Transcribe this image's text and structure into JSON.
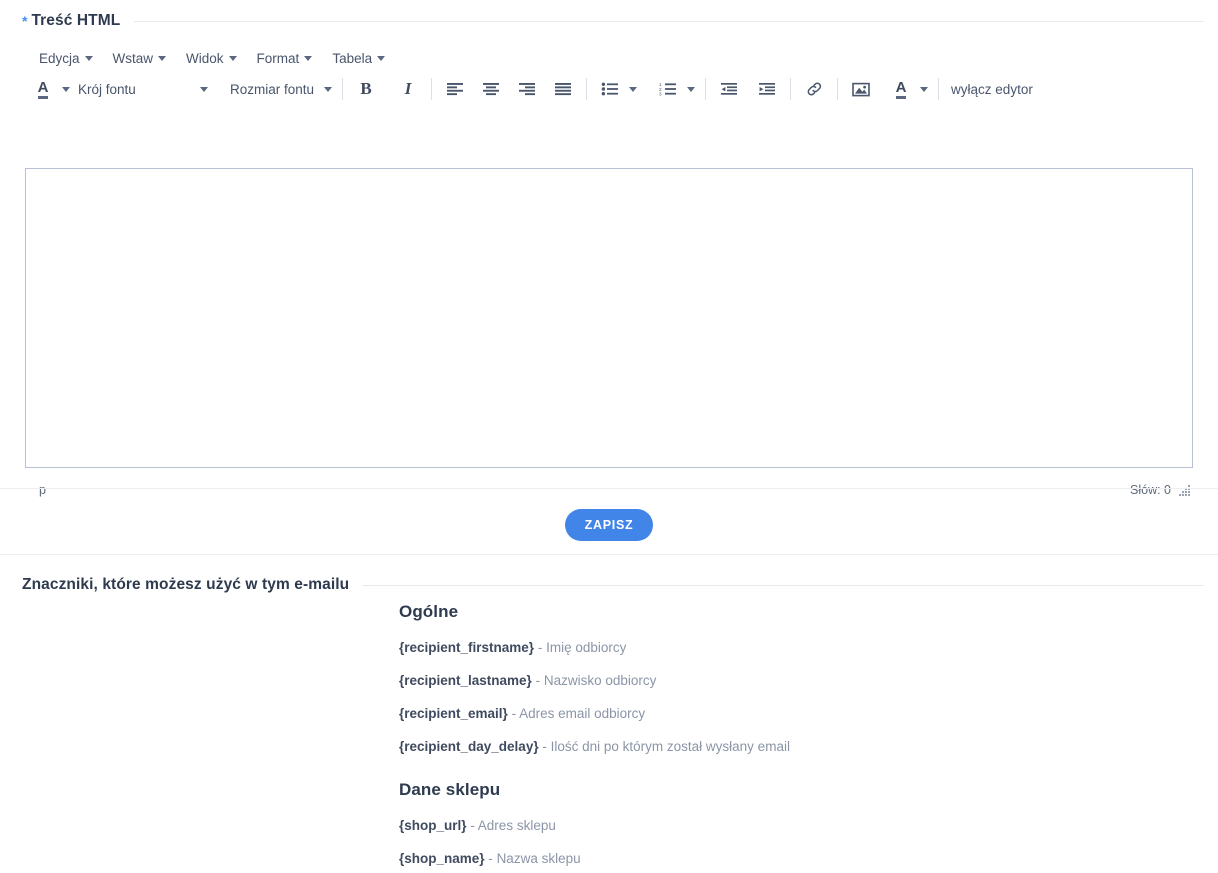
{
  "header": {
    "required_mark": "*",
    "title": "Treść HTML"
  },
  "editor": {
    "menubar": [
      {
        "label": "Edycja",
        "name": "menu-edycja"
      },
      {
        "label": "Wstaw",
        "name": "menu-wstaw"
      },
      {
        "label": "Widok",
        "name": "menu-widok"
      },
      {
        "label": "Format",
        "name": "menu-format"
      },
      {
        "label": "Tabela",
        "name": "menu-tabela"
      }
    ],
    "toolbar": {
      "text_color_icon": "text-color-A-icon",
      "font_family_label": "Krój fontu",
      "font_size_label": "Rozmiar fontu",
      "bold_icon": "bold-icon",
      "italic_icon": "italic-icon",
      "align_left_icon": "align-left-icon",
      "align_center_icon": "align-center-icon",
      "align_right_icon": "align-right-icon",
      "align_justify_icon": "align-justify-icon",
      "bullet_list_icon": "bullet-list-icon",
      "numbered_list_icon": "numbered-list-icon",
      "outdent_icon": "outdent-icon",
      "indent_icon": "indent-icon",
      "link_icon": "link-icon",
      "image_icon": "image-icon",
      "background_color_icon": "background-color-A-icon",
      "disable_editor_label": "wyłącz edytor"
    },
    "content": "",
    "statusbar": {
      "element_path": "p",
      "word_count": "Słów: 0",
      "resize_grip": "resize-grip-icon"
    }
  },
  "actions": {
    "save_label": "ZAPISZ"
  },
  "markers": {
    "section_title": "Znaczniki, które możesz użyć w tym e-mailu",
    "groups": [
      {
        "title": "Ogólne",
        "items": [
          {
            "token": "{recipient_firstname}",
            "sep": "-",
            "desc": "Imię odbiorcy"
          },
          {
            "token": "{recipient_lastname}",
            "sep": "-",
            "desc": "Nazwisko odbiorcy"
          },
          {
            "token": "{recipient_email}",
            "sep": "-",
            "desc": "Adres email odbiorcy"
          },
          {
            "token": "{recipient_day_delay}",
            "sep": "-",
            "desc": "Ilość dni po którym został wysłany email"
          }
        ]
      },
      {
        "title": "Dane sklepu",
        "items": [
          {
            "token": "{shop_url}",
            "sep": "-",
            "desc": "Adres sklepu"
          },
          {
            "token": "{shop_name}",
            "sep": "-",
            "desc": "Nazwa sklepu"
          }
        ]
      }
    ]
  },
  "colors": {
    "accent_blue": "#4285e8",
    "required_star": "#4a8df6",
    "heading": "#2e3a4e",
    "muted_text": "#8b95a7",
    "icon": "#4a566c",
    "border": "#b9c2d4"
  }
}
